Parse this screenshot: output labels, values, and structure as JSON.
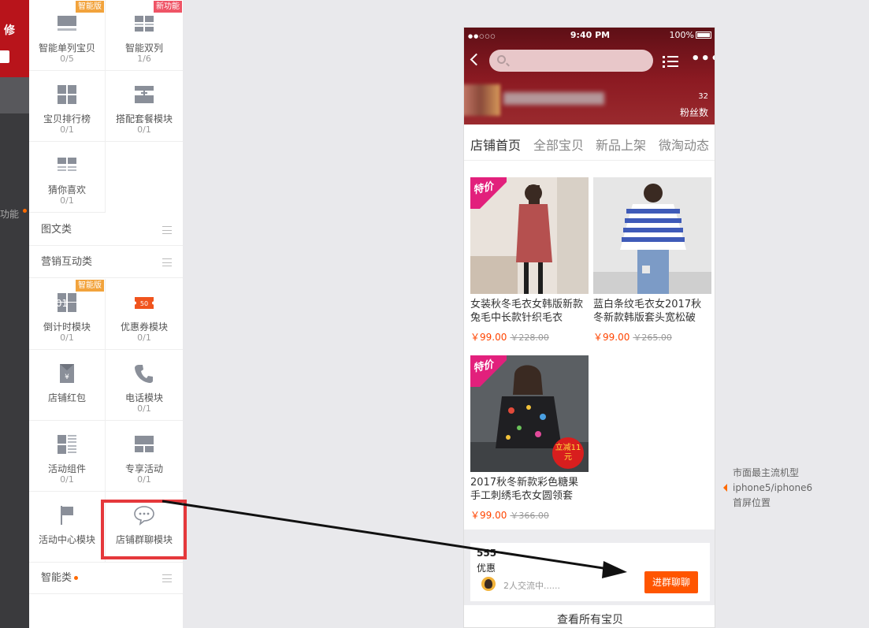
{
  "sidebar": {
    "top_label": "修",
    "function_label": "功能"
  },
  "modules_top": [
    {
      "name": "智能单列宝贝",
      "count": "0/5",
      "badge": "智能版",
      "badge_color": "#f2a33c",
      "icon": "single-list-icon"
    },
    {
      "name": "智能双列",
      "count": "1/6",
      "badge": "新功能",
      "badge_color": "#ef5466",
      "icon": "double-list-icon"
    },
    {
      "name": "宝贝排行榜",
      "count": "0/1",
      "icon": "ranking-grid-icon"
    },
    {
      "name": "搭配套餐模块",
      "count": "0/1",
      "icon": "combo-icon"
    },
    {
      "name": "猜你喜欢",
      "count": "0/1",
      "icon": "guess-like-icon"
    }
  ],
  "sections": {
    "image_text": "图文类",
    "marketing": "营销互动类",
    "smart": "智能类"
  },
  "modules_marketing": [
    {
      "name": "倒计时模块",
      "count": "0/1",
      "badge": "智能版",
      "badge_color": "#f2a33c",
      "icon": "countdown-icon",
      "icon_text": "01"
    },
    {
      "name": "优惠券模块",
      "count": "0/1",
      "icon": "coupon-icon",
      "icon_text": "50"
    },
    {
      "name": "店铺红包",
      "count": "",
      "icon": "red-packet-icon",
      "icon_text": "¥"
    },
    {
      "name": "电话模块",
      "count": "0/1",
      "icon": "phone-icon"
    },
    {
      "name": "活动组件",
      "count": "0/1",
      "icon": "activity-widget-icon"
    },
    {
      "name": "专享活动",
      "count": "0/1",
      "icon": "exclusive-activity-icon"
    },
    {
      "name": "活动中心模块",
      "count": "",
      "icon": "flag-icon"
    },
    {
      "name": "店铺群聊模块",
      "count": "",
      "icon": "chat-bubble-icon"
    }
  ],
  "phone": {
    "time": "9:40 PM",
    "battery": "100%",
    "fans_count": "32",
    "fans_label": "粉丝数",
    "tabs": [
      "店铺首页",
      "全部宝贝",
      "新品上架",
      "微淘动态"
    ],
    "badge_text": "特价",
    "products": [
      {
        "title": "女装秋冬毛衣女韩版新款 兔毛中长款针织毛衣",
        "price": "￥99.00",
        "old_price": "￥228.00"
      },
      {
        "title": "蓝白条纹毛衣女2017秋冬新款韩版套头宽松破",
        "price": "￥99.00",
        "old_price": "￥265.00"
      },
      {
        "title": "2017秋冬新款彩色糖果手工刺绣毛衣女圆领套",
        "price": "￥99.00",
        "old_price": "￥366.00",
        "promo": "立减11元"
      }
    ],
    "chat": {
      "number": "555",
      "label": "优惠",
      "talking": "2人交流中......",
      "button": "进群聊聊"
    },
    "view_all": "查看所有宝贝"
  },
  "note": {
    "line1": "市面最主流机型",
    "line2": "iphone5/iphone6",
    "line3": "首屏位置"
  },
  "colors": {
    "accent": "#ff5500",
    "highlight": "#e5383b",
    "header": "#8c1a22"
  }
}
